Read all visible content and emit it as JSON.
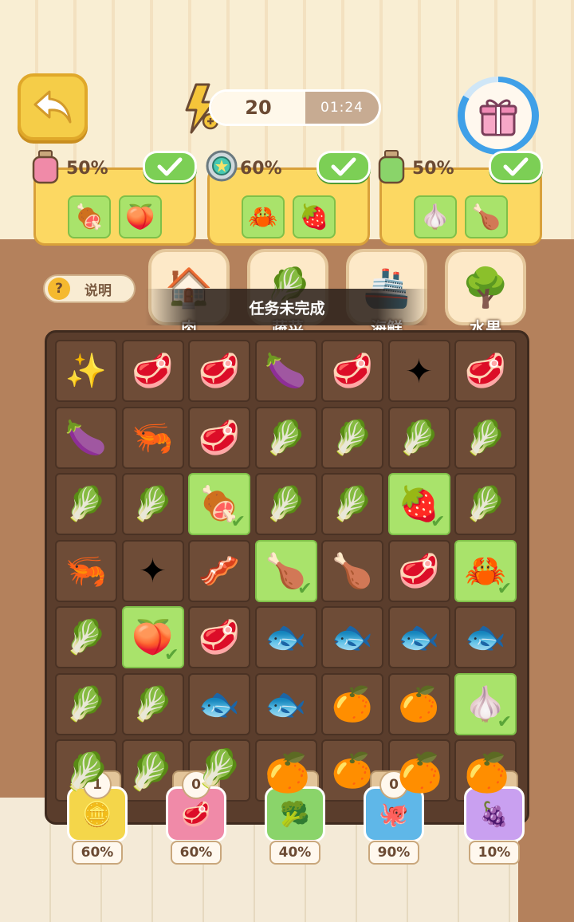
{
  "header": {
    "energy": "20",
    "timer": "01:24"
  },
  "tasks": [
    {
      "percent": "50%",
      "token": "pink-jar",
      "items": [
        "🍖",
        "🍑"
      ]
    },
    {
      "percent": "60%",
      "token": "coin",
      "items": [
        "🦀",
        "🍓"
      ]
    },
    {
      "percent": "50%",
      "token": "green-jar",
      "items": [
        "🧄",
        "🍗"
      ]
    }
  ],
  "help": {
    "label": "说明"
  },
  "categories": [
    {
      "label": "肉",
      "icon": "🏠"
    },
    {
      "label": "蔬菜",
      "icon": "🥬"
    },
    {
      "label": "海鲜",
      "icon": "🚢"
    },
    {
      "label": "水果",
      "icon": "🌳"
    }
  ],
  "toast": "任务未完成",
  "board": {
    "rows": [
      [
        "✨",
        "🥩",
        "🥩",
        "🍆",
        "🥩",
        "✦",
        "🥩"
      ],
      [
        "🍆",
        "🦐",
        "🥩",
        "🥬",
        "🥬",
        "🥬",
        "🥬"
      ],
      [
        "🥬",
        "🥬",
        "🍖",
        "🥬",
        "🥬",
        "🍓",
        "🥬"
      ],
      [
        "🦐",
        "✦",
        "🥓",
        "🍗",
        "🍗",
        "🥩",
        "🦀"
      ],
      [
        "🥬",
        "🍑",
        "🥩",
        "🐟",
        "🐟",
        "🐟",
        "🐟"
      ],
      [
        "🥬",
        "🥬",
        "🐟",
        "🐟",
        "🍊",
        "🍊",
        "🧄"
      ],
      [
        "🥬",
        "🥬",
        "🥬",
        "🍊",
        "🍊",
        "🍊",
        "🍊"
      ]
    ],
    "done": [
      [
        2,
        2
      ],
      [
        2,
        5
      ],
      [
        3,
        3
      ],
      [
        3,
        6
      ],
      [
        4,
        1
      ],
      [
        5,
        6
      ]
    ]
  },
  "jars": [
    {
      "count": "1",
      "percent": "60%",
      "icon": "🪙",
      "color": "#f4d64a"
    },
    {
      "count": "0",
      "percent": "60%",
      "icon": "🥩",
      "color": "#f08aa8"
    },
    {
      "count": "",
      "percent": "40%",
      "icon": "🥦",
      "color": "#8ad46a"
    },
    {
      "count": "0",
      "percent": "90%",
      "icon": "🐙",
      "color": "#5fb7e8"
    },
    {
      "count": "",
      "percent": "10%",
      "icon": "🍇",
      "color": "#c9a0f0"
    }
  ]
}
